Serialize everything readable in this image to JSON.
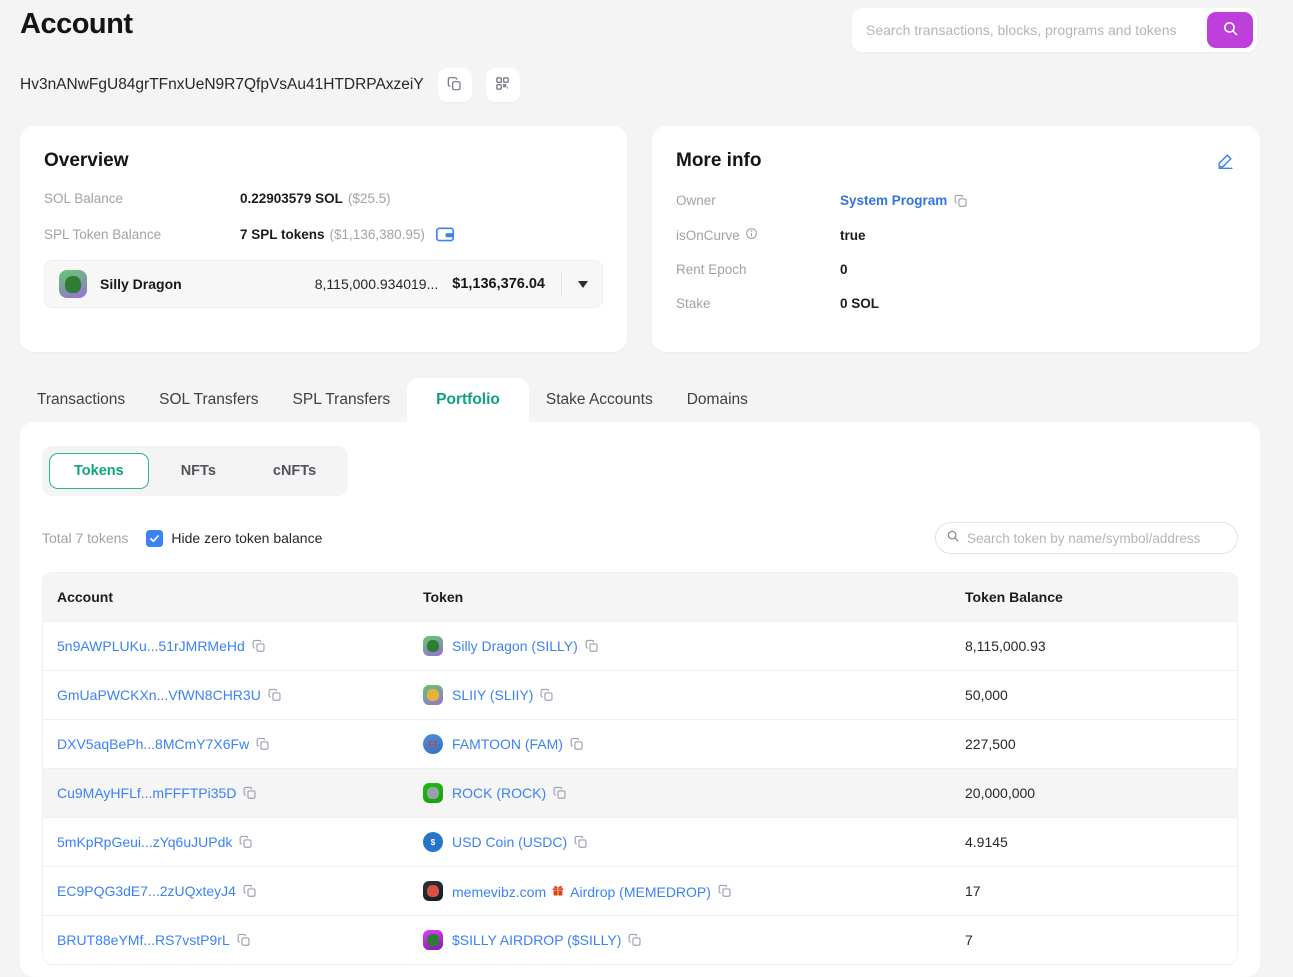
{
  "colors": {
    "accent_purple": "#be3fdc",
    "link_blue": "#3b82f6",
    "active_tab_green": "#0ea17d",
    "checkbox_blue": "#3b82f6",
    "page_bg": "#f4f4f5"
  },
  "header": {
    "title": "Account",
    "search_placeholder": "Search transactions, blocks, programs and tokens",
    "address": "Hv3nANwFgU84grTFnxUeN9R7QfpVsAu41HTDRPAxzeiY"
  },
  "overview": {
    "title": "Overview",
    "rows": [
      {
        "label": "SOL Balance",
        "value_bold": "0.22903579 SOL",
        "value_muted": "($25.5)"
      },
      {
        "label": "SPL Token Balance",
        "value_bold": "7 SPL tokens",
        "value_muted": "($1,136,380.95)",
        "wallet_icon": true
      }
    ],
    "token_selector": {
      "name": "Silly Dragon",
      "amount": "8,115,000.934019...",
      "usd": "$1,136,376.04",
      "icon": {
        "shape": "rounded",
        "colors": [
          "#63c96d",
          "#9b6ed8"
        ],
        "blob": "#2e7d32"
      }
    }
  },
  "more_info": {
    "title": "More info",
    "rows": [
      {
        "label": "Owner",
        "value": "System Program",
        "link": true,
        "copy": true
      },
      {
        "label": "isOnCurve",
        "info_icon": true,
        "value": "true"
      },
      {
        "label": "Rent Epoch",
        "value": "0"
      },
      {
        "label": "Stake",
        "value": "0 SOL"
      }
    ]
  },
  "tabs": [
    {
      "label": "Transactions",
      "active": false
    },
    {
      "label": "SOL Transfers",
      "active": false
    },
    {
      "label": "SPL Transfers",
      "active": false
    },
    {
      "label": "Portfolio",
      "active": true
    },
    {
      "label": "Stake Accounts",
      "active": false
    },
    {
      "label": "Domains",
      "active": false
    }
  ],
  "portfolio": {
    "subtabs": [
      {
        "label": "Tokens",
        "active": true
      },
      {
        "label": "NFTs",
        "active": false
      },
      {
        "label": "cNFTs",
        "active": false
      }
    ],
    "total_text": "Total 7 tokens",
    "hide_zero_label": "Hide zero token balance",
    "hide_zero_checked": true,
    "token_search_placeholder": "Search token by name/symbol/address",
    "table": {
      "columns": [
        "Account",
        "Token",
        "Token Balance"
      ],
      "rows": [
        {
          "account": "5n9AWPLUKu...51rJMRMeHd",
          "token": "Silly Dragon (SILLY)",
          "balance": "8,115,000.93",
          "highlight": false,
          "icon": {
            "shape": "rounded",
            "colors": [
              "#63c96d",
              "#9b6ed8"
            ],
            "blob": "#2e7d32"
          }
        },
        {
          "account": "GmUaPWCKXn...VfWN8CHR3U",
          "token": "SLIIY (SLIIY)",
          "balance": "50,000",
          "highlight": false,
          "icon": {
            "shape": "rounded",
            "colors": [
              "#63c96d",
              "#9b6ed8"
            ],
            "blob": "#e8b23a"
          }
        },
        {
          "account": "DXV5aqBePh...8MCmY7X6Fw",
          "token": "FAMTOON (FAM)",
          "balance": "227,500",
          "highlight": false,
          "icon": {
            "shape": "circle",
            "colors": [
              "#4a90d9",
              "#3a6fc0"
            ],
            "glyph": "FT",
            "glyph_color": "#e23c30"
          }
        },
        {
          "account": "Cu9MAyHFLf...mFFFTPi35D",
          "token": "ROCK (ROCK)",
          "balance": "20,000,000",
          "highlight": true,
          "icon": {
            "shape": "rounded",
            "colors": [
              "#1fb814",
              "#18a010"
            ],
            "blob": "#9aa0a8"
          }
        },
        {
          "account": "5mKpRpGeui...zYq6uJUPdk",
          "token": "USD Coin (USDC)",
          "balance": "4.9145",
          "highlight": false,
          "icon": {
            "shape": "circle",
            "colors": [
              "#2775ca",
              "#2775ca"
            ],
            "glyph": "$",
            "glyph_color": "#ffffff"
          }
        },
        {
          "account": "EC9PQG3dE7...2zUQxteyJ4",
          "token": "memevibz.com 🎁 Airdrop (MEMEDROP)",
          "balance": "17",
          "highlight": false,
          "icon": {
            "shape": "rounded",
            "colors": [
              "#2b3340",
              "#151b26"
            ],
            "blob": "#d94f43"
          }
        },
        {
          "account": "BRUT88eYMf...RS7vstP9rL",
          "token": "$SILLY AIRDROP ($SILLY)",
          "balance": "7",
          "highlight": false,
          "icon": {
            "shape": "rounded",
            "colors": [
              "#e040fb",
              "#7b1fa2"
            ],
            "blob": "#2e7d32"
          }
        }
      ]
    }
  }
}
